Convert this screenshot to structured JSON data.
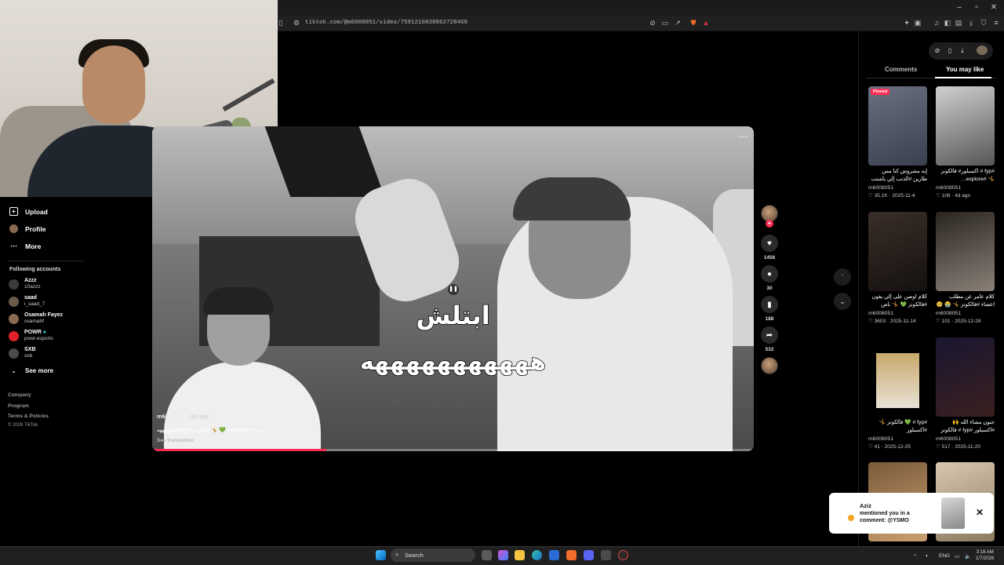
{
  "browser": {
    "url": "tiktok.com/@m6008051/video/7591210838862728469",
    "minimize_icon": "–",
    "maximize_icon": "▫",
    "close_icon": "✕"
  },
  "sidebar": {
    "nav": [
      {
        "label": "Upload",
        "icon": "plus-square-icon"
      },
      {
        "label": "Profile",
        "icon": "avatar"
      },
      {
        "label": "More",
        "icon": "ellipsis-icon"
      }
    ],
    "following_title": "Following accounts",
    "accounts": [
      {
        "name": "Azzz",
        "handle": "10azzz",
        "color": "#3b3b3b"
      },
      {
        "name": "saad",
        "handle": "i_saad_7",
        "color": "#6b5a4a"
      },
      {
        "name": "Osamah Fayez",
        "handle": "osamahf",
        "color": "#8a6a50"
      },
      {
        "name": "POWR",
        "handle": "powr.esports",
        "color": "#e0202a"
      },
      {
        "name": "SXB",
        "handle": "sxb",
        "color": "#4a4a4a"
      }
    ],
    "see_more": "See more",
    "footer": [
      "Company",
      "Program",
      "Terms & Policies",
      "© 2026 TikTok"
    ]
  },
  "video": {
    "caption_line1": "ابتلش",
    "caption_line2": "هههههههههههه",
    "author": "m6008051",
    "age": "· 3d ago",
    "description": "هههههههه#fyp #فالكونز 🤸 💚 #explore #ضبح ...",
    "see_translation": "See translation",
    "progress": 0.29
  },
  "actions": {
    "likes": "1456",
    "comments": "30",
    "saves": "188",
    "shares": "532"
  },
  "right_panel": {
    "tabs": [
      "Comments",
      "You may like"
    ],
    "active_tab": "You may like",
    "cards": [
      {
        "pinned": "Pinned",
        "title": "إيه مشروش كنا مس طارين #الذنب إلي ياشنت #fyp...",
        "user": "m6008051",
        "stats": "♡ 35.1K · 2025-11-4",
        "bg": "#5a5f70"
      },
      {
        "pinned": "",
        "title": "#fyp # اكسبلور# فالكونز 🤸 #explore...",
        "user": "m6008051",
        "stats": "♡ 108 · 4d ago",
        "bg": "#9a9a9a"
      },
      {
        "pinned": "",
        "title": "كلام اوضن على إلي يغون #فالكونز 💚 🤸 ناص",
        "user": "m6008051",
        "stats": "♡ 3603 · 2025-11-14",
        "bg": "#2c2420"
      },
      {
        "pinned": "",
        "title": "كلام عامر عن مطلب اعضاء #فالكونز 🤸 😭 🥺 #fyp...",
        "user": "m6008051",
        "stats": "♡ 101 · 2025-12-28",
        "bg": "#3a3530"
      },
      {
        "pinned": "",
        "title": "#fyp # 💚 فالكونز 🤸 #اكسبلور",
        "user": "m6008051",
        "stats": "♡ 41 · 2025-12-25",
        "bg": "#e9e2d6"
      },
      {
        "pinned": "",
        "title": "جنون مشاء الله 🙌 #اكسبلور #fyp # فالكونز",
        "user": "m6008051",
        "stats": "♡ 517 · 2025-11-20",
        "bg": "#1a1630"
      },
      {
        "pinned": "",
        "title": "",
        "user": "",
        "stats": "",
        "bg": "#7a5a3a"
      },
      {
        "pinned": "",
        "title": "",
        "user": "",
        "stats": "",
        "bg": "#c9b8a0"
      }
    ]
  },
  "toast": {
    "name": "Aziz",
    "message": "mentioned you in a comment: @YSMO",
    "close": "✕"
  },
  "taskbar": {
    "search": "Search",
    "lang": "ENG",
    "time": "3:18 AM",
    "date": "1/7/2026"
  }
}
